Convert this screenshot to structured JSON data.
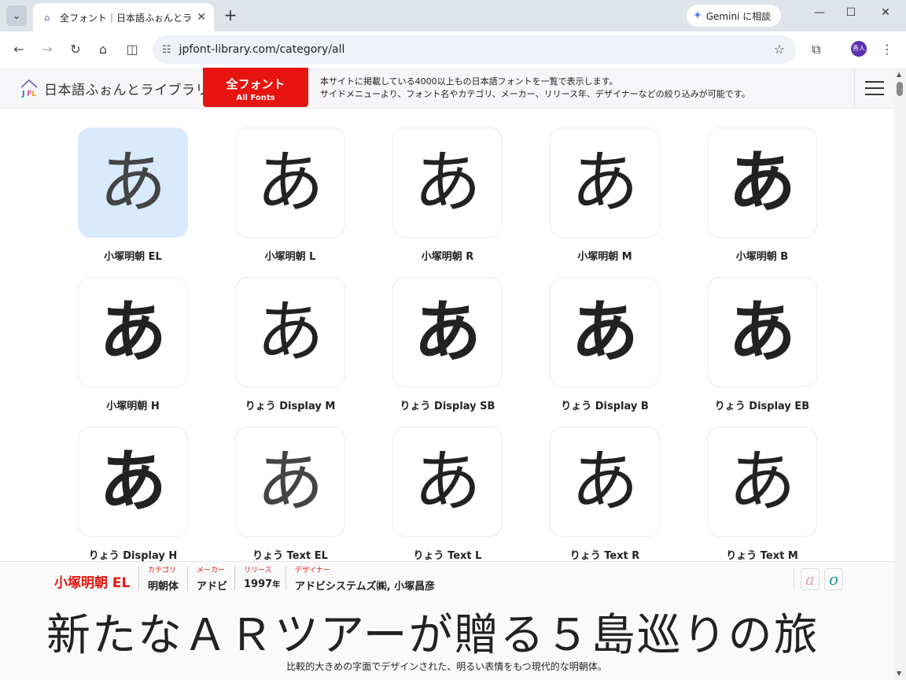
{
  "browser": {
    "tab_title": "全フォント｜日本語ふぉんとライブラリ",
    "tab_close": "✕",
    "new_tab": "+",
    "gemini_label": "Gemini に相談",
    "url": "jpfont-library.com/category/all",
    "profile_initials": "秀人",
    "icons": [
      "back-icon",
      "forward-icon",
      "reload-icon",
      "home-icon",
      "split-view-icon",
      "site-info-icon",
      "bookmark-star-icon",
      "extensions-icon",
      "menu-kebab-icon"
    ]
  },
  "header": {
    "logo_text": "日本語ふぉんとライブラリ",
    "all_fonts_jp": "全フォント",
    "all_fonts_en": "All Fonts",
    "desc_line1": "本サイトに掲載している4000以上もの日本語フォントを一覧で表示します。",
    "desc_line2": "サイドメニューより、フォント名やカテゴリ、メーカー、リリース年、デザイナーなどの絞り込みが可能です。"
  },
  "glyph": "あ",
  "fonts": [
    {
      "name": "小塚明朝 EL",
      "weight": 200
    },
    {
      "name": "小塚明朝 L",
      "weight": 300
    },
    {
      "name": "小塚明朝 R",
      "weight": 400
    },
    {
      "name": "小塚明朝 M",
      "weight": 500
    },
    {
      "name": "小塚明朝 B",
      "weight": 700
    },
    {
      "name": "小塚明朝 H",
      "weight": 900
    },
    {
      "name": "りょう Display M",
      "weight": 500
    },
    {
      "name": "りょう Display SB",
      "weight": 600
    },
    {
      "name": "りょう Display B",
      "weight": 700
    },
    {
      "name": "りょう Display EB",
      "weight": 800
    },
    {
      "name": "りょう Display H",
      "weight": 900
    },
    {
      "name": "りょう Text EL",
      "weight": 200
    },
    {
      "name": "りょう Text L",
      "weight": 300
    },
    {
      "name": "りょう Text R",
      "weight": 400
    },
    {
      "name": "りょう Text M",
      "weight": 500
    }
  ],
  "selected_index": 0,
  "panel": {
    "font_name": "小塚明朝 EL",
    "category_label": "カテゴリ",
    "category": "明朝体",
    "maker_label": "メーカー",
    "maker": "アドビ",
    "release_label": "リリース",
    "release_year": "1997",
    "release_suffix": "年",
    "designer_label": "デザイナー",
    "designer": "アドビシステムズ㈱, 小塚昌彦",
    "style_a": "a",
    "style_o": "o",
    "sample_text": "新たなＡＲツアーが贈る５島巡りの旅",
    "caption": "比較的大きめの字面でデザインされた、明るい表情をもつ現代的な明朝体。"
  },
  "colors": {
    "accent": "#e8140f",
    "selected_tile": "#d8eafc"
  }
}
